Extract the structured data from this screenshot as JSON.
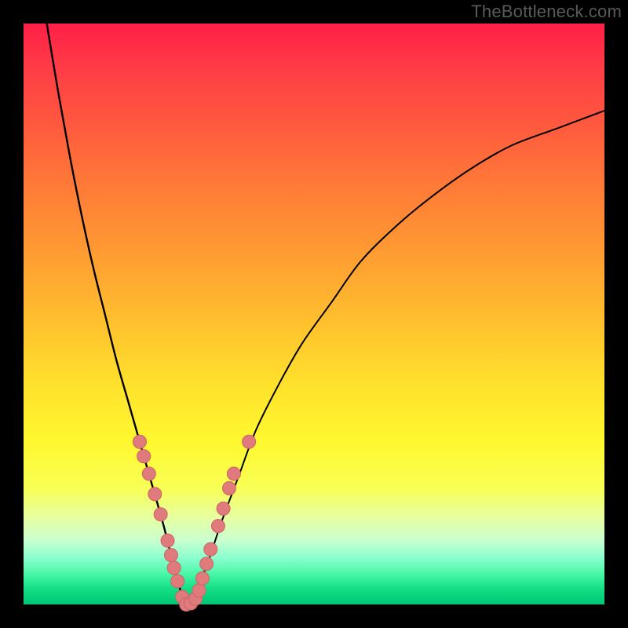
{
  "watermark": "TheBottleneck.com",
  "colors": {
    "frame": "#000000",
    "curve": "#000000",
    "marker_fill": "#e07b7d",
    "marker_stroke": "#cf6264",
    "gradient_top": "#ff1f46",
    "gradient_bottom": "#00c673"
  },
  "chart_data": {
    "type": "line",
    "title": "",
    "xlabel": "",
    "ylabel": "",
    "xlim": [
      0,
      100
    ],
    "ylim": [
      0,
      100
    ],
    "grid": false,
    "legend": false,
    "axes_hidden": true,
    "background_gradient": "red→orange→yellow→green (vertical)",
    "series": [
      {
        "name": "left-branch",
        "x": [
          4,
          6,
          8,
          10,
          12,
          14,
          16,
          18,
          20,
          22,
          24,
          25,
          26,
          27,
          28
        ],
        "y": [
          100,
          88,
          77,
          67,
          58,
          50,
          42,
          35,
          28,
          21,
          14,
          10,
          6,
          2.5,
          0
        ]
      },
      {
        "name": "right-branch",
        "x": [
          28,
          30,
          32,
          34,
          37,
          40,
          44,
          48,
          53,
          58,
          64,
          70,
          77,
          84,
          92,
          100
        ],
        "y": [
          0,
          3,
          8,
          14,
          22,
          30,
          38,
          45,
          52,
          59,
          65,
          70,
          75,
          79,
          82,
          85
        ]
      }
    ],
    "markers": [
      {
        "series": "left-branch",
        "x": 20.0,
        "y": 28.0
      },
      {
        "series": "left-branch",
        "x": 20.7,
        "y": 25.5
      },
      {
        "series": "left-branch",
        "x": 21.6,
        "y": 22.5
      },
      {
        "series": "left-branch",
        "x": 22.6,
        "y": 19.0
      },
      {
        "series": "left-branch",
        "x": 23.6,
        "y": 15.5
      },
      {
        "series": "left-branch",
        "x": 24.8,
        "y": 11.0
      },
      {
        "series": "left-branch",
        "x": 25.4,
        "y": 8.5
      },
      {
        "series": "left-branch",
        "x": 25.9,
        "y": 6.3
      },
      {
        "series": "left-branch",
        "x": 26.5,
        "y": 4.0
      },
      {
        "series": "left-branch",
        "x": 27.3,
        "y": 1.3
      },
      {
        "series": "left-branch",
        "x": 28.0,
        "y": 0.0
      },
      {
        "series": "right-branch",
        "x": 28.8,
        "y": 0.2
      },
      {
        "series": "right-branch",
        "x": 29.6,
        "y": 1.0
      },
      {
        "series": "right-branch",
        "x": 30.2,
        "y": 2.4
      },
      {
        "series": "right-branch",
        "x": 30.8,
        "y": 4.5
      },
      {
        "series": "right-branch",
        "x": 31.5,
        "y": 7.0
      },
      {
        "series": "right-branch",
        "x": 32.2,
        "y": 9.5
      },
      {
        "series": "right-branch",
        "x": 33.5,
        "y": 13.5
      },
      {
        "series": "right-branch",
        "x": 34.4,
        "y": 16.5
      },
      {
        "series": "right-branch",
        "x": 35.4,
        "y": 20.0
      },
      {
        "series": "right-branch",
        "x": 36.2,
        "y": 22.5
      },
      {
        "series": "right-branch",
        "x": 38.8,
        "y": 28.0
      }
    ]
  }
}
